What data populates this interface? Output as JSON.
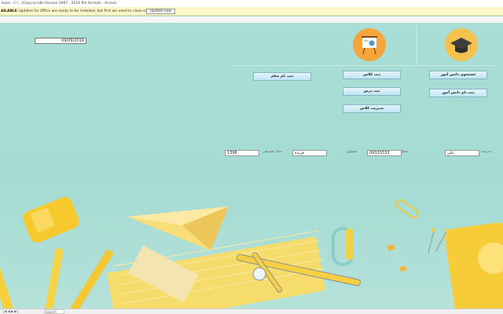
{
  "window": {
    "title": "base : C:\\...\\Copy.accdb (Access 2007 - 2016 file format) - Access"
  },
  "message_bar": {
    "label": "AILABLE",
    "text": "Updates for Office are ready to be installed, but first we need to close some apps.",
    "button_label": "Update now"
  },
  "form": {
    "date_value": "09/09/2019",
    "buttons": {
      "search_student": "جستجوی دانش آموز",
      "register_student": "ثبت نام دانش آموز",
      "register_class": "ثبت کلاس",
      "register_lesson": "ثبت درس",
      "manage_classes": "مدیریت کلاس",
      "register_teacher": "ثبت نام معلم"
    },
    "fields": {
      "school": {
        "label": "مدرسه",
        "value": "علی"
      },
      "grade": {
        "label": "مقطع",
        "value": ""
      },
      "phone": {
        "label": "مسئول",
        "value": "09333333"
      },
      "name": {
        "label": "",
        "value": "فریده"
      },
      "year": {
        "label": "سال تحصیلی",
        "value": "1398"
      }
    }
  },
  "status_bar": {
    "nav": "|◀ ◀ ▶ ▶|",
    "search": "Search"
  },
  "colors": {
    "background": "#a8ddd5",
    "button": "#cdeaf5",
    "accent_yellow": "#f8d348",
    "accent_orange": "#f7a53b"
  }
}
